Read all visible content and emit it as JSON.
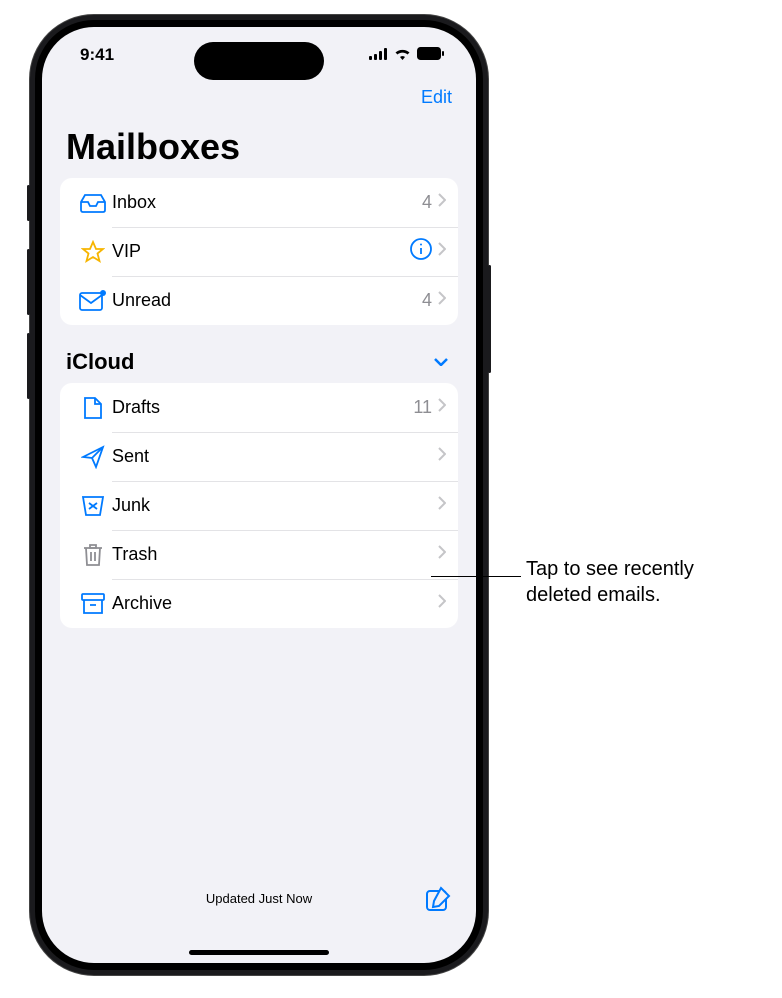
{
  "status": {
    "time": "9:41"
  },
  "nav": {
    "edit": "Edit"
  },
  "title": "Mailboxes",
  "smart": {
    "items": [
      {
        "label": "Inbox",
        "count": "4",
        "icon": "inbox"
      },
      {
        "label": "VIP",
        "count": "",
        "icon": "star",
        "info": true
      },
      {
        "label": "Unread",
        "count": "4",
        "icon": "unread"
      }
    ]
  },
  "section": {
    "title": "iCloud"
  },
  "icloud": {
    "items": [
      {
        "label": "Drafts",
        "count": "11",
        "icon": "doc"
      },
      {
        "label": "Sent",
        "count": "",
        "icon": "send"
      },
      {
        "label": "Junk",
        "count": "",
        "icon": "junk"
      },
      {
        "label": "Trash",
        "count": "",
        "icon": "trash"
      },
      {
        "label": "Archive",
        "count": "",
        "icon": "archive"
      }
    ]
  },
  "toolbar": {
    "status": "Updated Just Now"
  },
  "callout": {
    "line1": "Tap to see recently",
    "line2": "deleted emails."
  }
}
